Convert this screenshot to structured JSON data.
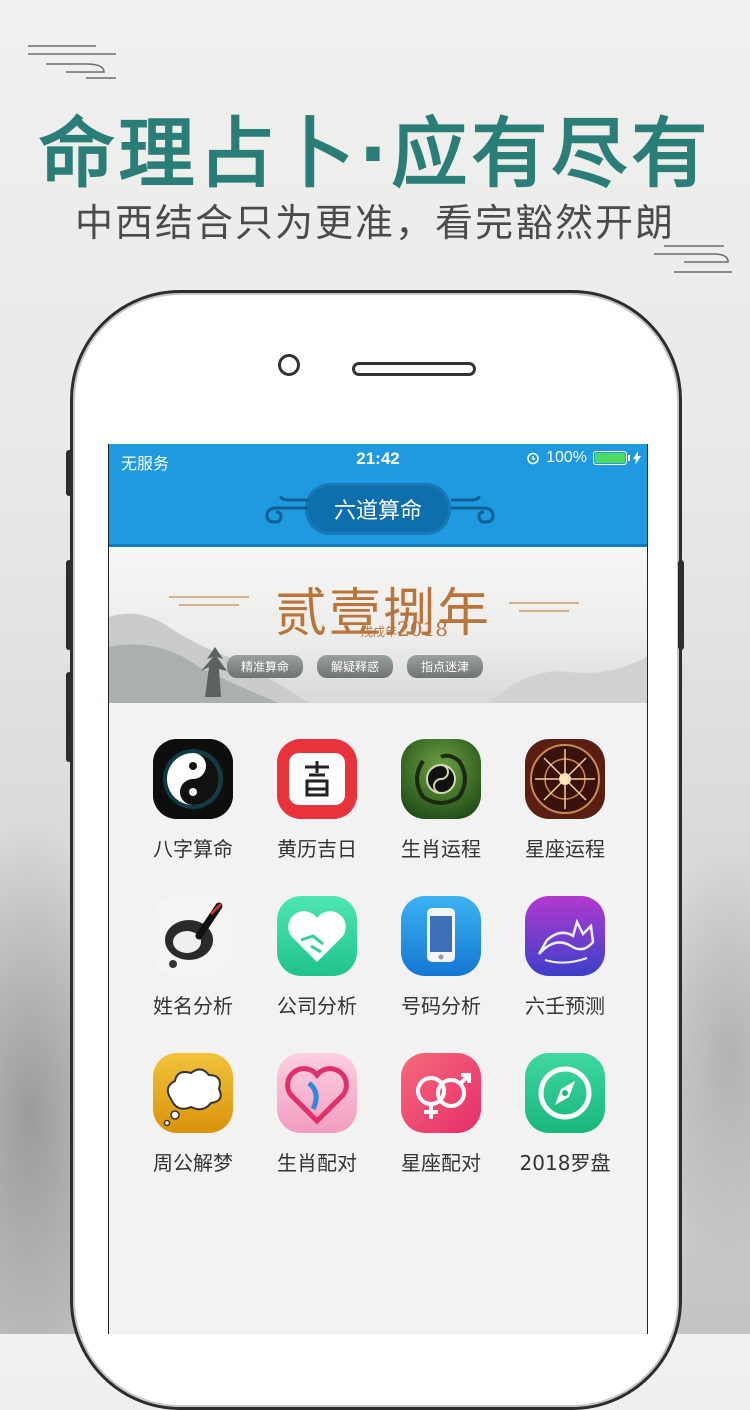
{
  "promo": {
    "headline": "命理占卜·应有尽有",
    "subline": "中西结合只为更准，看完豁然开朗"
  },
  "status_bar": {
    "carrier": "无服务",
    "time": "21:42",
    "battery": "100%",
    "battery_level": 1.0
  },
  "nav": {
    "title": "六道算命"
  },
  "banner": {
    "title": "贰壹捌年",
    "year_prefix": "戊戌年",
    "year": "2018",
    "tags": [
      "精准算命",
      "解疑释惑",
      "指点迷津"
    ]
  },
  "apps": [
    {
      "label": "八字算命",
      "icon": "yin-yang-icon"
    },
    {
      "label": "黄历吉日",
      "icon": "calendar-ji-icon"
    },
    {
      "label": "生肖运程",
      "icon": "dragon-icon"
    },
    {
      "label": "星座运程",
      "icon": "zodiac-wheel-icon"
    },
    {
      "label": "姓名分析",
      "icon": "ink-brush-icon"
    },
    {
      "label": "公司分析",
      "icon": "handshake-heart-icon"
    },
    {
      "label": "号码分析",
      "icon": "phone-icon"
    },
    {
      "label": "六壬预测",
      "icon": "fox-icon"
    },
    {
      "label": "周公解梦",
      "icon": "cloud-dream-icon"
    },
    {
      "label": "生肖配对",
      "icon": "heart-pair-icon"
    },
    {
      "label": "星座配对",
      "icon": "gender-pair-icon"
    },
    {
      "label": "2018罗盘",
      "icon": "compass-icon"
    }
  ],
  "colors": {
    "accent": "#2b7d78",
    "nav_blue": "#1f9ae0"
  }
}
